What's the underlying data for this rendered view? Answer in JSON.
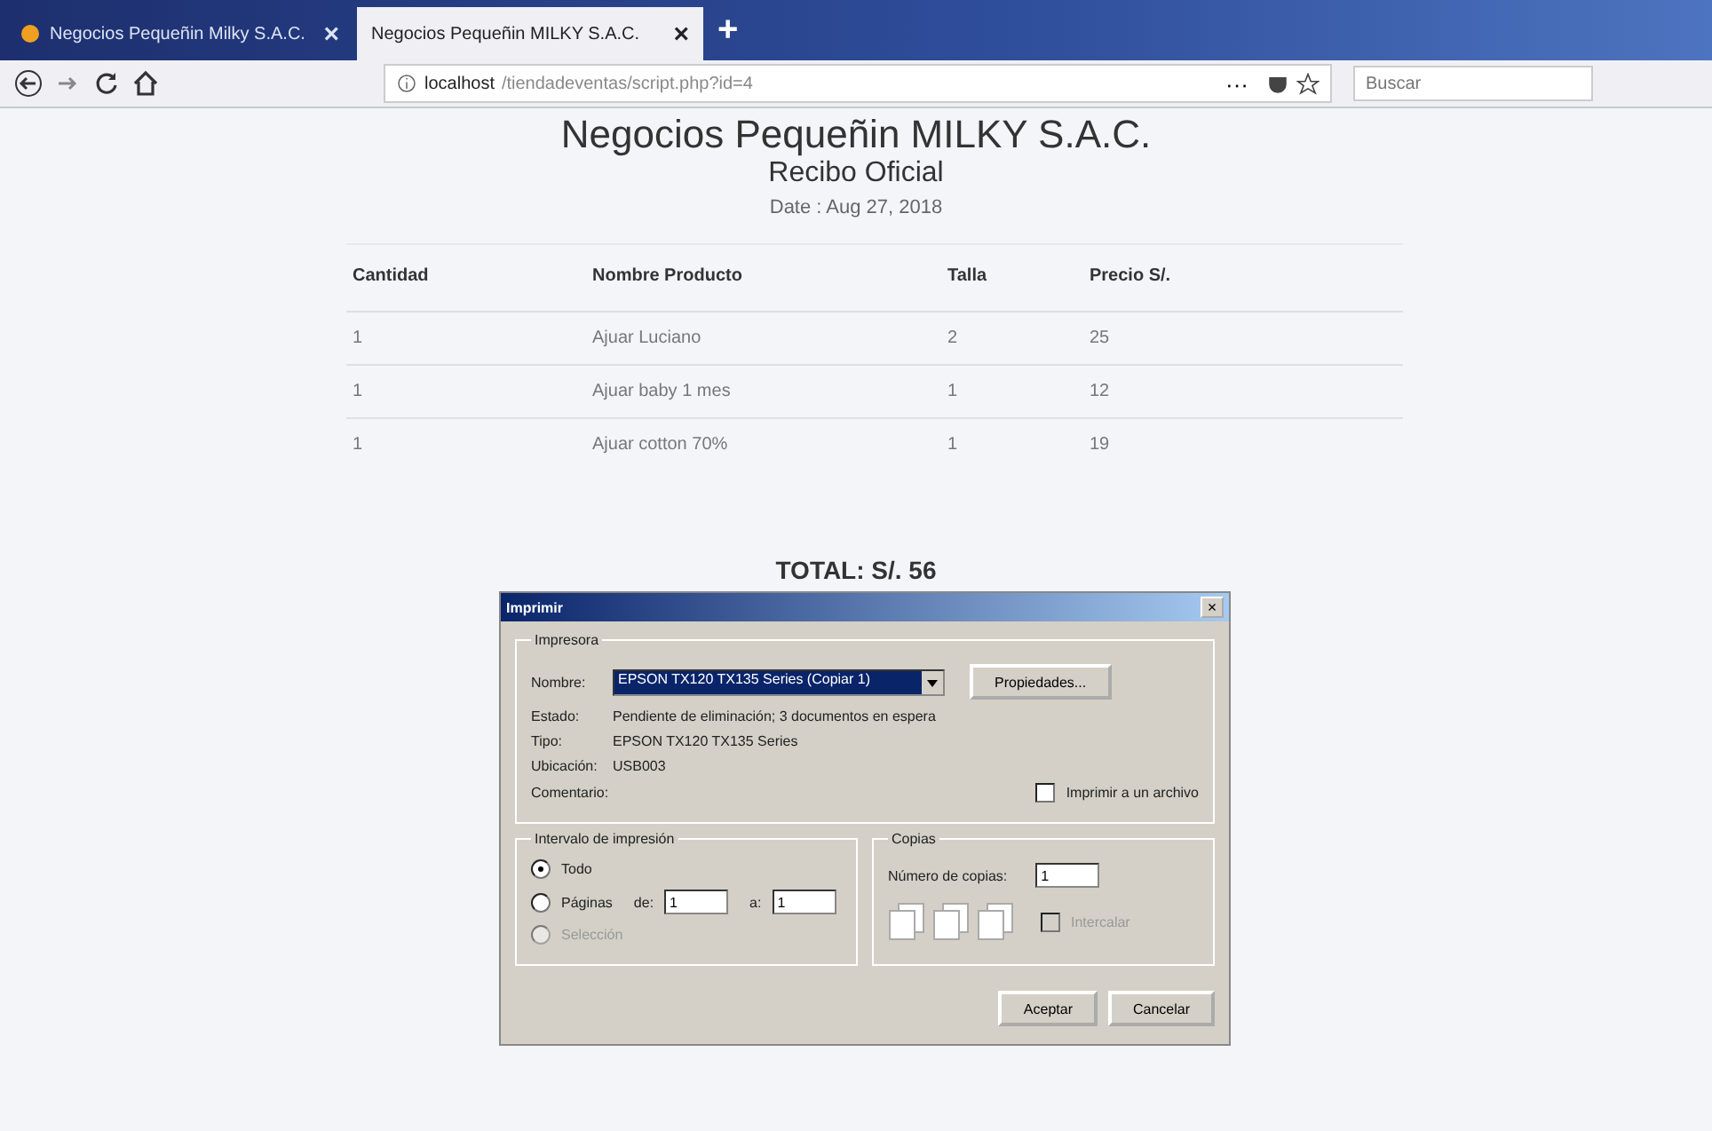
{
  "browser": {
    "tabs": [
      {
        "label": "Negocios Pequeñin Milky S.A.C.",
        "selected": false,
        "close": "×"
      },
      {
        "label": "Negocios Pequeñin MILKY S.A.C.",
        "selected": true,
        "close": "×"
      }
    ],
    "new_tab": "+",
    "url_host": "localhost",
    "url_path": "/tiendadeventas/script.php?id=4",
    "more": "···",
    "search": {
      "placeholder": "Buscar"
    }
  },
  "receipt": {
    "company": "Negocios Pequeñin MILKY S.A.C.",
    "title": "Recibo Oficial",
    "date": "Date : Aug 27, 2018",
    "columns": [
      "Cantidad",
      "Nombre Producto",
      "Talla",
      "Precio S/."
    ],
    "rows": [
      [
        "1",
        "Ajuar Luciano",
        "2",
        "25"
      ],
      [
        "1",
        "Ajuar baby 1 mes",
        "1",
        "12"
      ],
      [
        "1",
        "Ajuar cotton 70%",
        "1",
        "19"
      ]
    ],
    "total": "TOTAL: S/. 56"
  },
  "dialog": {
    "title": "Imprimir",
    "close": "×",
    "printer_group": "Impresora",
    "name_label": "Nombre:",
    "printer": "EPSON TX120 TX135 Series (Copiar 1)",
    "properties": "Propiedades...",
    "info": [
      {
        "label": "Estado:",
        "value": "Pendiente de eliminación; 3 documentos en espera"
      },
      {
        "label": "Tipo:",
        "value": "EPSON TX120 TX135 Series"
      },
      {
        "label": "Ubicación:",
        "value": "USB003"
      },
      {
        "label": "Comentario:"
      }
    ],
    "print_to_file": {
      "label": "Imprimir a un archivo",
      "checked": false
    },
    "range_group": "Intervalo de impresión",
    "range": [
      {
        "label": "Todo",
        "selected": true,
        "disabled": false
      },
      {
        "label": "Páginas",
        "selected": false,
        "disabled": false
      },
      {
        "label": "Selección",
        "selected": false,
        "disabled": true
      }
    ],
    "from_label": "de:",
    "from": "1",
    "to_label": "a:",
    "to": "1",
    "copies_group": "Copias",
    "copies_label": "Número de copias:",
    "copies": "1",
    "collate": {
      "label": "Intercalar",
      "checked": false,
      "disabled": true
    },
    "buttons": [
      "Aceptar",
      "Cancelar"
    ]
  }
}
